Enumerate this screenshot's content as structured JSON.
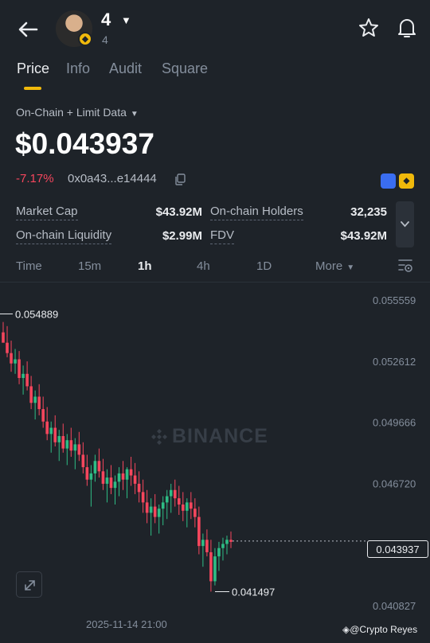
{
  "header": {
    "token_name": "4",
    "token_sub": "4",
    "back_icon": "arrow-left-icon",
    "favorite_icon": "star-icon",
    "alert_icon": "bell-icon"
  },
  "tabs": [
    {
      "label": "Price",
      "active": true
    },
    {
      "label": "Info",
      "active": false
    },
    {
      "label": "Audit",
      "active": false
    },
    {
      "label": "Square",
      "active": false
    }
  ],
  "price_panel": {
    "data_source": "On-Chain + Limit Data",
    "price": "$0.043937",
    "change": "-7.17%",
    "address": "0x0a43...e14444",
    "change_color": "#f6465d"
  },
  "stats": {
    "market_cap_label": "Market Cap",
    "market_cap_value": "$43.92M",
    "holders_label": "On-chain Holders",
    "holders_value": "32,235",
    "liquidity_label": "On-chain Liquidity",
    "liquidity_value": "$2.99M",
    "fdv_label": "FDV",
    "fdv_value": "$43.92M"
  },
  "intervals": [
    {
      "label": "Time",
      "active": false
    },
    {
      "label": "15m",
      "active": false
    },
    {
      "label": "1h",
      "active": true
    },
    {
      "label": "4h",
      "active": false
    },
    {
      "label": "1D",
      "active": false
    },
    {
      "label": "More",
      "active": false
    }
  ],
  "chart": {
    "y_ticks": [
      "0.055559",
      "0.052612",
      "0.049666",
      "0.046720",
      "0.043937",
      "0.040827"
    ],
    "high_label": "0.054889",
    "low_label": "0.041497",
    "last_price": "0.043937",
    "x_label": "2025-11-14 21:00",
    "watermark": "BINANCE",
    "attribution": "@Crypto Reyes",
    "up_color": "#2ebd85",
    "down_color": "#f6465d"
  },
  "chart_data": {
    "type": "candlestick",
    "interval": "1h",
    "ylim": [
      0.040827,
      0.055559
    ],
    "y_ticks": [
      0.055559,
      0.052612,
      0.049666,
      0.04672,
      0.040827
    ],
    "highest": 0.054889,
    "lowest": 0.041497,
    "last": 0.043937,
    "x_label": "2025-11-14 21:00",
    "candles": [
      [
        0.054,
        0.0545,
        0.0538,
        0.0535
      ],
      [
        0.0535,
        0.0543,
        0.0528,
        0.053
      ],
      [
        0.053,
        0.0536,
        0.0521,
        0.0525
      ],
      [
        0.0525,
        0.0532,
        0.052,
        0.0527
      ],
      [
        0.0527,
        0.0531,
        0.0515,
        0.0518
      ],
      [
        0.0518,
        0.0524,
        0.051,
        0.052
      ],
      [
        0.052,
        0.0526,
        0.0512,
        0.0514
      ],
      [
        0.0514,
        0.0519,
        0.0503,
        0.0506
      ],
      [
        0.0506,
        0.0512,
        0.0498,
        0.0509
      ],
      [
        0.0509,
        0.0515,
        0.05,
        0.0503
      ],
      [
        0.0503,
        0.0509,
        0.0494,
        0.0497
      ],
      [
        0.0497,
        0.0504,
        0.0488,
        0.0491
      ],
      [
        0.0491,
        0.0497,
        0.0482,
        0.0494
      ],
      [
        0.0494,
        0.05,
        0.0485,
        0.0487
      ],
      [
        0.0487,
        0.0493,
        0.0478,
        0.049
      ],
      [
        0.049,
        0.0496,
        0.0482,
        0.0484
      ],
      [
        0.0484,
        0.0491,
        0.0476,
        0.0488
      ],
      [
        0.0488,
        0.0494,
        0.048,
        0.0483
      ],
      [
        0.0483,
        0.0489,
        0.0474,
        0.0486
      ],
      [
        0.0486,
        0.0492,
        0.0478,
        0.0481
      ],
      [
        0.0481,
        0.0487,
        0.0472,
        0.0475
      ],
      [
        0.0475,
        0.0481,
        0.0466,
        0.0469
      ],
      [
        0.0469,
        0.0476,
        0.0456,
        0.0472
      ],
      [
        0.0472,
        0.0481,
        0.0468,
        0.0478
      ],
      [
        0.0478,
        0.0484,
        0.047,
        0.0473
      ],
      [
        0.0473,
        0.0479,
        0.0464,
        0.0467
      ],
      [
        0.0467,
        0.0474,
        0.0458,
        0.047
      ],
      [
        0.047,
        0.0476,
        0.0462,
        0.0465
      ],
      [
        0.0465,
        0.0471,
        0.0457,
        0.0468
      ],
      [
        0.0468,
        0.0475,
        0.0461,
        0.0472
      ],
      [
        0.0472,
        0.0478,
        0.0464,
        0.0469
      ],
      [
        0.0469,
        0.0475,
        0.046,
        0.0474
      ],
      [
        0.0474,
        0.048,
        0.0466,
        0.0471
      ],
      [
        0.0471,
        0.0477,
        0.0462,
        0.0467
      ],
      [
        0.0467,
        0.0473,
        0.0458,
        0.0463
      ],
      [
        0.0463,
        0.0469,
        0.0453,
        0.0458
      ],
      [
        0.0458,
        0.0464,
        0.0448,
        0.0453
      ],
      [
        0.0453,
        0.046,
        0.0442,
        0.0456
      ],
      [
        0.0456,
        0.0462,
        0.0448,
        0.0451
      ],
      [
        0.0451,
        0.0457,
        0.0443,
        0.0455
      ],
      [
        0.0455,
        0.0461,
        0.0447,
        0.0458
      ],
      [
        0.0458,
        0.0464,
        0.045,
        0.0461
      ],
      [
        0.0461,
        0.0467,
        0.0453,
        0.0464
      ],
      [
        0.0464,
        0.0469,
        0.0456,
        0.046
      ],
      [
        0.046,
        0.0466,
        0.0452,
        0.0457
      ],
      [
        0.0457,
        0.0463,
        0.0449,
        0.0454
      ],
      [
        0.0454,
        0.046,
        0.0446,
        0.0458
      ],
      [
        0.0458,
        0.0463,
        0.045,
        0.0455
      ],
      [
        0.0455,
        0.046,
        0.0446,
        0.0451
      ],
      [
        0.0451,
        0.0456,
        0.0433,
        0.0437
      ],
      [
        0.0437,
        0.0443,
        0.0427,
        0.044
      ],
      [
        0.044,
        0.0445,
        0.0432,
        0.0434
      ],
      [
        0.0434,
        0.044,
        0.0415,
        0.042
      ],
      [
        0.042,
        0.0436,
        0.0418,
        0.0432
      ],
      [
        0.0432,
        0.0439,
        0.0425,
        0.0436
      ],
      [
        0.0436,
        0.0441,
        0.043,
        0.0438
      ],
      [
        0.0438,
        0.0442,
        0.0433,
        0.044
      ],
      [
        0.044,
        0.0444,
        0.0436,
        0.0439
      ]
    ]
  }
}
